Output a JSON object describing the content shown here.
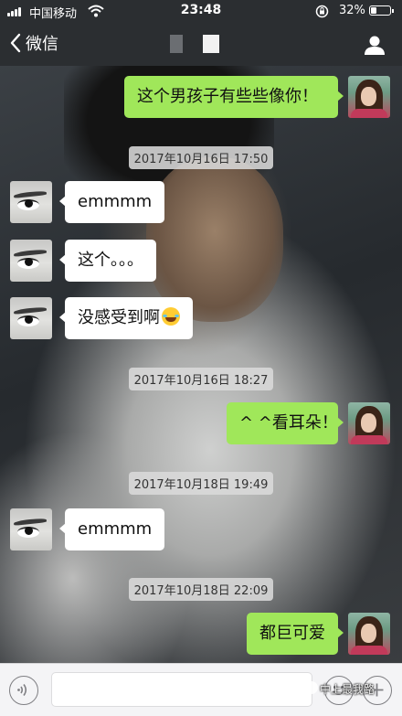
{
  "status_bar": {
    "carrier": "中国移动",
    "time": "23:48",
    "battery_percent": "32%",
    "battery_level": 0.32,
    "icons": [
      "signal-icon",
      "wifi-icon",
      "rotation-lock-icon",
      "battery-icon"
    ]
  },
  "nav": {
    "back_label": "微信",
    "icons": [
      "chevron-left-icon",
      "person-icon"
    ]
  },
  "messages": [
    {
      "type": "msg",
      "side": "right",
      "text": "这个男孩子有些些像你！"
    },
    {
      "type": "time",
      "text": "2017年10月16日 17:50"
    },
    {
      "type": "msg",
      "side": "left",
      "text": "emmmm"
    },
    {
      "type": "msg",
      "side": "left",
      "text": "这个。。。"
    },
    {
      "type": "msg",
      "side": "left",
      "text": "没感受到啊",
      "emoji": "tears-of-joy"
    },
    {
      "type": "time",
      "text": "2017年10月16日 18:27"
    },
    {
      "type": "msg",
      "side": "right",
      "text": "^ ^看耳朵！"
    },
    {
      "type": "time",
      "text": "2017年10月18日 19:49"
    },
    {
      "type": "msg",
      "side": "left",
      "text": "emmmm"
    },
    {
      "type": "time",
      "text": "2017年10月18日 22:09"
    },
    {
      "type": "msg",
      "side": "right",
      "text": "都巨可爱"
    }
  ],
  "input_bar": {
    "value": "",
    "icons": [
      "voice-icon",
      "emoji-icon",
      "plus-icon"
    ]
  },
  "watermark": "中上最我路"
}
